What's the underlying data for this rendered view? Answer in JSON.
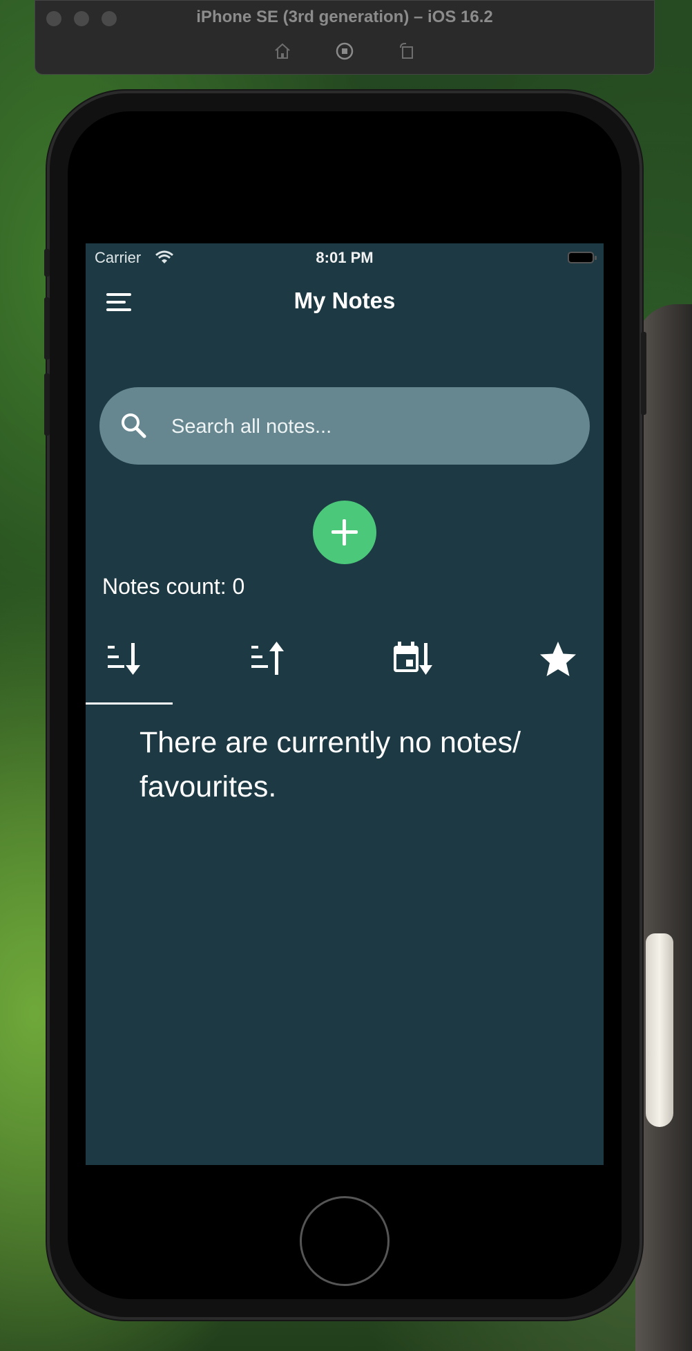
{
  "simulator": {
    "title": "iPhone SE (3rd generation) – iOS 16.2",
    "icons": [
      "home-icon",
      "screenshot-icon",
      "rotate-icon"
    ]
  },
  "status_bar": {
    "carrier": "Carrier",
    "time": "8:01 PM"
  },
  "app": {
    "title": "My Notes",
    "search": {
      "placeholder": "Search all notes...",
      "value": ""
    },
    "notes_count": "Notes count: 0",
    "tabs": [
      {
        "icon": "sort-descending-icon",
        "selected": true
      },
      {
        "icon": "sort-ascending-icon",
        "selected": false
      },
      {
        "icon": "calendar-sort-icon",
        "selected": false
      },
      {
        "icon": "star-icon",
        "selected": false
      }
    ],
    "empty_message": "There are currently no notes/ favourites."
  },
  "colors": {
    "screen_bg": "#1d3a44",
    "search_bg": "#668790",
    "fab": "#4cc87a"
  }
}
